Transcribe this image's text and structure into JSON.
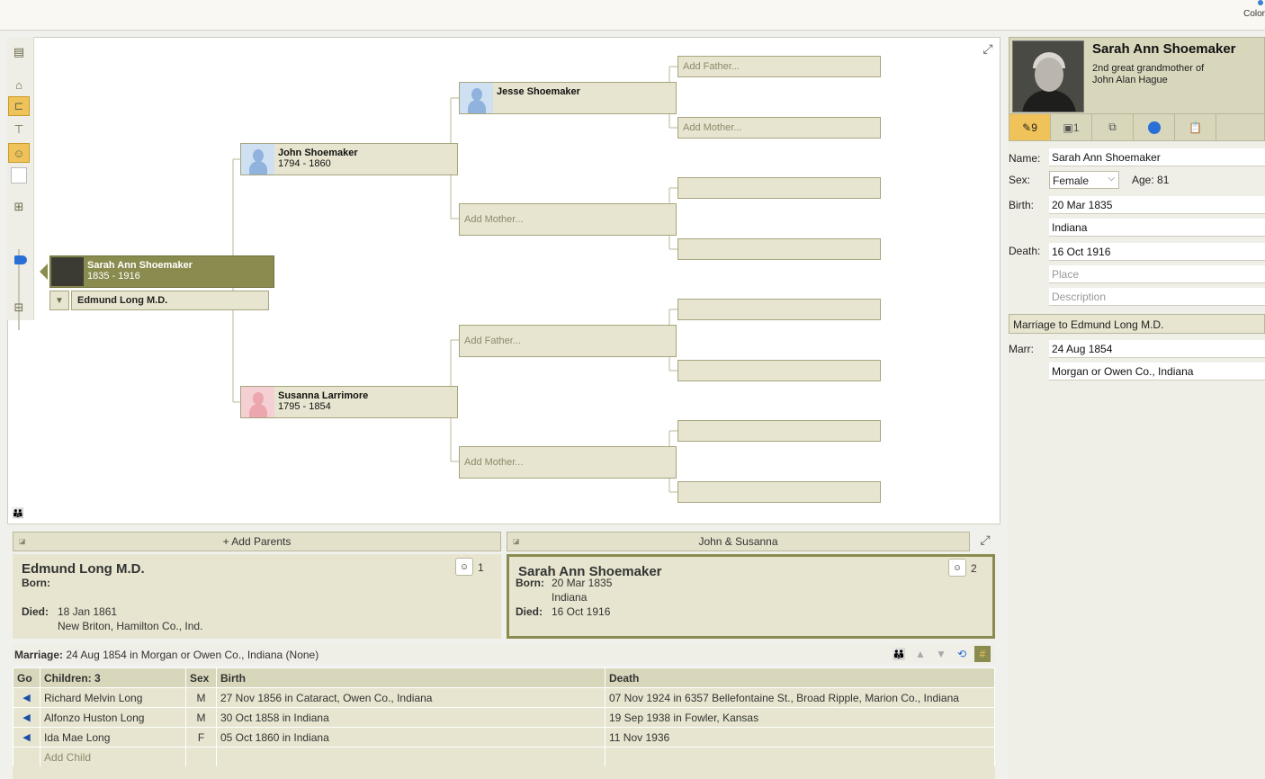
{
  "topbar": {
    "color_label": "Color"
  },
  "tree": {
    "root": {
      "name": "Sarah Ann Shoemaker",
      "dates": "1835 - 1916"
    },
    "spouse": {
      "name": "Edmund Long M.D."
    },
    "father": {
      "name": "John Shoemaker",
      "dates": "1794 - 1860"
    },
    "mother": {
      "name": "Susanna Larrimore",
      "dates": "1795 - 1854"
    },
    "paternal_grandfather": {
      "name": "Jesse Shoemaker"
    },
    "placeholders": {
      "add_father": "Add Father...",
      "add_mother": "Add Mother..."
    }
  },
  "right_panel": {
    "name": "Sarah Ann Shoemaker",
    "relationship_line1": "2nd great grandmother of",
    "relationship_line2": "John Alan Hague",
    "tabs": [
      {
        "icon": "facts-icon",
        "count": "9"
      },
      {
        "icon": "sources-icon",
        "count": "1"
      },
      {
        "icon": "media-icon",
        "count": ""
      },
      {
        "icon": "web-icon",
        "count": ""
      },
      {
        "icon": "notes-icon",
        "count": ""
      }
    ],
    "labels": {
      "name": "Name:",
      "sex": "Sex:",
      "birth": "Birth:",
      "death": "Death:",
      "marr": "Marr:"
    },
    "fields": {
      "name": "Sarah Ann Shoemaker",
      "sex": "Female",
      "age": "Age: 81",
      "birth_date": "20 Mar 1835",
      "birth_place": "Indiana",
      "death_date": "16 Oct 1916",
      "death_place_placeholder": "Place",
      "death_desc_placeholder": "Description",
      "marriage_header": "Marriage to Edmund Long M.D.",
      "marr_date": "24 Aug 1854",
      "marr_place": "Morgan or Owen Co., Indiana"
    }
  },
  "family": {
    "left_bar": "+ Add Parents",
    "right_bar": "John & Susanna",
    "husband": {
      "name": "Edmund Long M.D.",
      "born_label": "Born:",
      "born": "",
      "died_label": "Died:",
      "died_date": "18 Jan 1861",
      "died_place": "New Briton, Hamilton Co., Ind.",
      "count": "1"
    },
    "wife": {
      "name": "Sarah Ann Shoemaker",
      "born_label": "Born:",
      "born_date": "20 Mar 1835",
      "born_place": "Indiana",
      "died_label": "Died:",
      "died_date": "16 Oct 1916",
      "count": "2"
    },
    "marriage_label": "Marriage:",
    "marriage_text": "24 Aug 1854 in Morgan or Owen Co., Indiana (None)",
    "children_headers": [
      "Go",
      "Children: 3",
      "Sex",
      "Birth",
      "Death"
    ],
    "children": [
      {
        "name": "Richard Melvin Long",
        "sex": "M",
        "birth": "27 Nov 1856 in Cataract, Owen Co., Indiana",
        "death": "07 Nov 1924 in 6357 Bellefontaine St., Broad Ripple, Marion Co., Indiana"
      },
      {
        "name": "Alfonzo Huston Long",
        "sex": "M",
        "birth": "30 Oct 1858 in Indiana",
        "death": "19 Sep 1938 in Fowler, Kansas"
      },
      {
        "name": "Ida Mae Long",
        "sex": "F",
        "birth": "05 Oct 1860 in Indiana",
        "death": "11 Nov 1936"
      }
    ],
    "add_child": "Add Child"
  },
  "colors": {
    "accent": "#8a8c4f",
    "box": "#e7e5cf",
    "highlight": "#f0c35a",
    "link": "#1b4fa8"
  }
}
